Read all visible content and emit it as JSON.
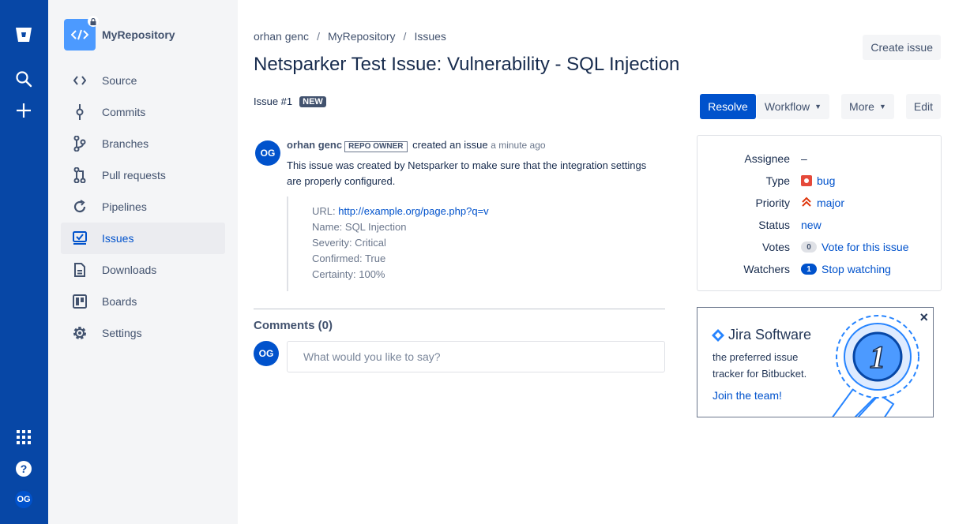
{
  "global_nav": {
    "icons": [
      "bitbucket-logo-icon",
      "search-icon",
      "create-icon",
      "apps-icon",
      "help-icon"
    ],
    "avatar": "OG"
  },
  "sidebar": {
    "repo_name": "MyRepository",
    "items": [
      {
        "label": "Source",
        "icon": "source-icon"
      },
      {
        "label": "Commits",
        "icon": "commits-icon"
      },
      {
        "label": "Branches",
        "icon": "branches-icon"
      },
      {
        "label": "Pull requests",
        "icon": "pull-requests-icon"
      },
      {
        "label": "Pipelines",
        "icon": "pipelines-icon"
      },
      {
        "label": "Issues",
        "icon": "issues-icon",
        "active": true
      },
      {
        "label": "Downloads",
        "icon": "downloads-icon"
      },
      {
        "label": "Boards",
        "icon": "boards-icon"
      },
      {
        "label": "Settings",
        "icon": "settings-icon"
      }
    ]
  },
  "breadcrumb": {
    "user": "orhan genc",
    "sep": "/",
    "repo": "MyRepository",
    "section": "Issues"
  },
  "create_issue_label": "Create issue",
  "issue": {
    "title": "Netsparker Test Issue: Vulnerability - SQL Injection",
    "number": "Issue #1",
    "status_lozenge": "NEW"
  },
  "actions": {
    "resolve": "Resolve",
    "workflow": "Workflow",
    "more": "More",
    "edit": "Edit"
  },
  "comment": {
    "avatar": "OG",
    "author": "orhan genc",
    "badge": "REPO OWNER",
    "action": "created an issue",
    "time": "a minute ago",
    "description": "This issue was created by Netsparker to make sure that the integration settings are properly configured.",
    "details": {
      "url_label": "URL: ",
      "url": "http://example.org/page.php?q=v",
      "name": "Name: SQL Injection",
      "severity": "Severity: Critical",
      "confirmed": "Confirmed: True",
      "certainty": "Certainty: 100%"
    }
  },
  "comments": {
    "heading": "Comments (0)",
    "avatar": "OG",
    "placeholder": "What would you like to say?"
  },
  "meta": {
    "assignee_label": "Assignee",
    "assignee": "–",
    "type_label": "Type",
    "type": "bug",
    "priority_label": "Priority",
    "priority": "major",
    "status_label": "Status",
    "status": "new",
    "votes_label": "Votes",
    "votes_count": "0",
    "vote_link": "Vote for this issue",
    "watchers_label": "Watchers",
    "watchers_count": "1",
    "watch_link": "Stop watching"
  },
  "promo": {
    "title": "Jira Software",
    "text": "the preferred issue tracker for Bitbucket.",
    "link": "Join the team!",
    "close": "×",
    "badge_number": "1"
  },
  "colors": {
    "nav": "#0747a6",
    "primary": "#0052cc",
    "sidebar": "#f4f5f7",
    "bug": "#e5493a",
    "priority": "#de350b"
  }
}
